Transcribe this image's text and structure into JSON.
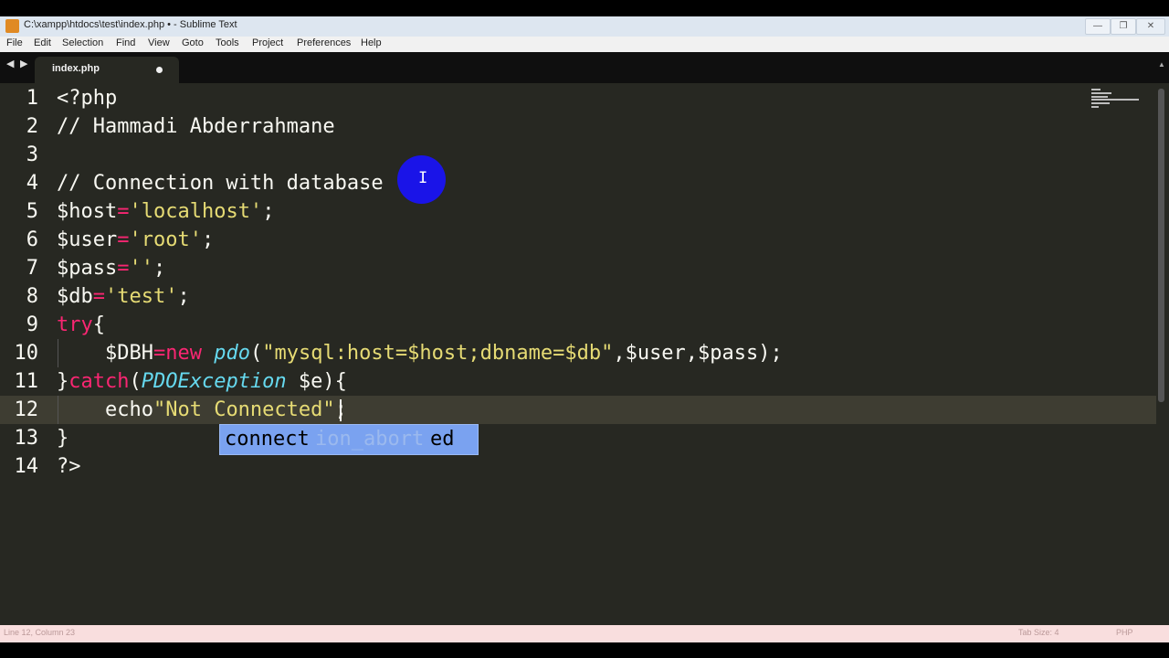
{
  "window": {
    "title": "C:\\xampp\\htdocs\\test\\index.php • - Sublime Text",
    "buttons": [
      "—",
      "❐",
      "✕"
    ]
  },
  "menu": [
    "File",
    "Edit",
    "Selection",
    "Find",
    "View",
    "Goto",
    "Tools",
    "Project",
    "Preferences",
    "Help"
  ],
  "tab": {
    "label": "index.php",
    "nav_back": "◀",
    "nav_forward": "▶",
    "scroll_up": "▲"
  },
  "gutter": [
    "1",
    "2",
    "3",
    "4",
    "5",
    "6",
    "7",
    "8",
    "9",
    "10",
    "11",
    "12",
    "13",
    "14"
  ],
  "current_line": "12",
  "code": {
    "l1": "<?php",
    "l2": "// Hammadi Abderrahmane",
    "l4": "// Connection with database",
    "l5_var": "$host",
    "l5_op": "=",
    "l5_str": "'localhost'",
    "l5_end": ";",
    "l6_var": "$user",
    "l6_op": "=",
    "l6_str": "'root'",
    "l6_end": ";",
    "l7_var": "$pass",
    "l7_op": "=",
    "l7_str": "''",
    "l7_end": ";",
    "l8_var": "$db",
    "l8_op": "=",
    "l8_str": "'test'",
    "l8_end": ";",
    "l9_kw": "try",
    "l9_end": "{",
    "l10_var": "    $DBH",
    "l10_op": "=",
    "l10_kw": "new",
    "l10_sp": " ",
    "l10_fn": "pdo",
    "l10_p": "(",
    "l10_str": "\"mysql:host=$host;dbname=$db\"",
    "l10_end": ",$user,$pass);",
    "l11_a": "}",
    "l11_kw": "catch",
    "l11_p": "(",
    "l11_cls": "PDOException",
    "l11_end": " $e){",
    "l12_a": "    echo",
    "l12_str": "\"Not Connected",
    "l12_str2": "\"",
    "l12_end": ";",
    "l13": "}",
    "l14": "?>"
  },
  "cursor": {
    "ibeam": "I"
  },
  "autocomplete": {
    "typed": "connect",
    "faded": "ion_abort",
    "suffix": "ed"
  },
  "status": {
    "left": "Line 12, Column 23",
    "right1": "Tab Size: 4",
    "right2": "PHP"
  },
  "colors": {
    "editor_bg": "#272822",
    "keyword": "#f92672",
    "string": "#e6db74",
    "function": "#66d9ef",
    "autocomplete_bg": "#7aa2f0",
    "cursor_highlight": "#1a14e8"
  }
}
